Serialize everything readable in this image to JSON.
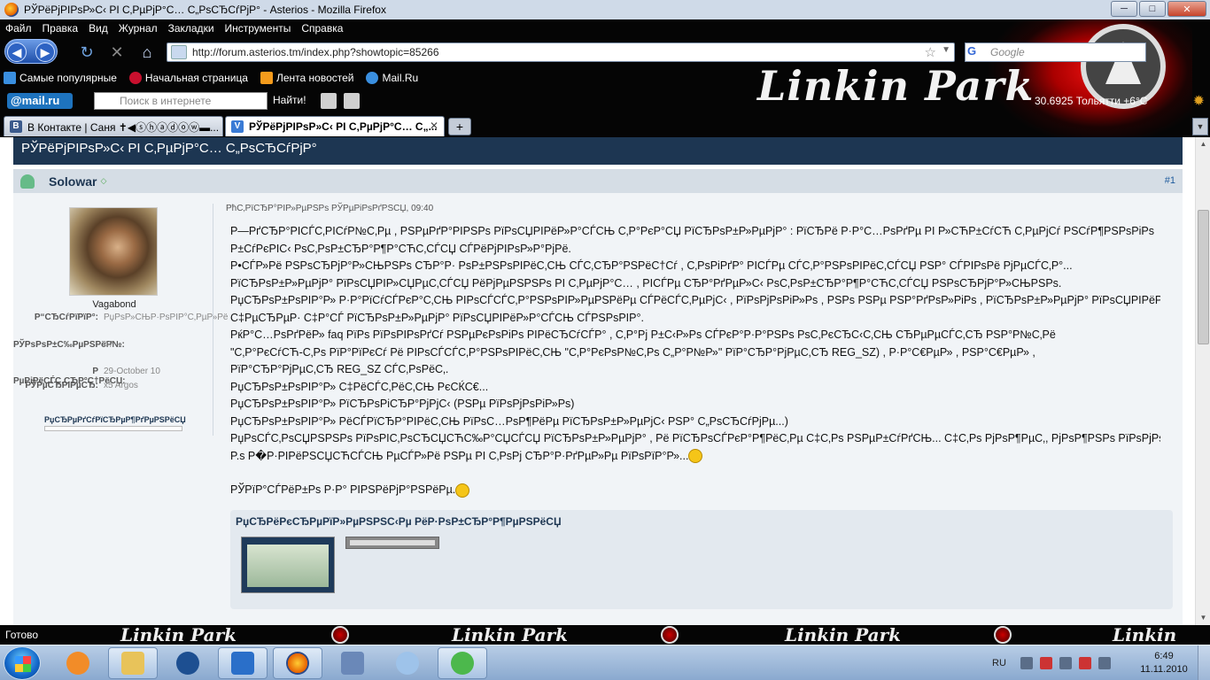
{
  "window": {
    "title": "РЎРёРјРІРѕР»С‹ РІ С‚РµРјР°С… С„РѕСЂСѓРјР° - Asterios - Mozilla Firefox",
    "buttons": {
      "minimize": "─",
      "maximize": "□",
      "close": "✕"
    }
  },
  "menubar": [
    "Файл",
    "Правка",
    "Вид",
    "Журнал",
    "Закладки",
    "Инструменты",
    "Справка"
  ],
  "navbar": {
    "url": "http://forum.asterios.tm/index.php?showtopic=85266",
    "search_placeholder": "Google",
    "search_engine_icon": "G"
  },
  "bookmarks": [
    {
      "label": "Самые популярные",
      "icon": "bookmark-icon",
      "color": "#3a8fe0"
    },
    {
      "label": "Начальная страница",
      "icon": "firefox-icon",
      "color": "#c8102e"
    },
    {
      "label": "Лента новостей",
      "icon": "rss-icon",
      "color": "#f49b1c"
    },
    {
      "label": "Mail.Ru",
      "icon": "mailru-icon",
      "color": "#3a8fe0"
    }
  ],
  "mailbar": {
    "logo": "@mail.ru",
    "search_placeholder": "Поиск в интернете",
    "find_label": "Найти!",
    "weather": "30.6925  Тольятти +6°C"
  },
  "persona_text": "Linkin Park",
  "tabs": [
    {
      "label": "В Контакте | Саня ✝◀ⓢⓗⓐⓓⓞⓦ▬...",
      "favicon": "В",
      "color": "#3b5a8c",
      "active": false
    },
    {
      "label": "РЎРёРјРІРѕР»С‹ РІ С‚РµРјР°С… С„...",
      "favicon": "V",
      "color": "#3a7bd5",
      "active": true
    }
  ],
  "forum": {
    "topic_title": "РЎРёРјРІРѕР»С‹ РІ С‚РµРјР°С… С„РѕСЂСѓРјР°",
    "post": {
      "author": "Solowar",
      "number": "#1",
      "date": "РћС‚РїСЂР°РІР»РµРЅРѕ РЎРµРіРѕРґРЅСЏ, 09:40",
      "avatar_name": "Vagabond",
      "user_info": [
        {
          "key": "Р“СЂСѓРїРїР°:",
          "value": "РџРѕР»СЊР·РѕРІР°С‚РµР»Рё"
        },
        {
          "key": "РЎРѕРѕР±С‰РµРЅРёР№:",
          "value": "47"
        },
        {
          "key": "Р РµРіРёСЃС‚СЂР°С†РёСЏ:",
          "value": "29-October 10"
        },
        {
          "key": "РЎРµСЂРІРµСЂ:",
          "value": "x5 Argos"
        }
      ],
      "reputation_label": "РџСЂРµРґСѓРїСЂРµР¶РґРµРЅРёСЏ",
      "lines": [
        "Р—РґСЂР°РІСЃС‚РІСѓР№С‚Рµ , РЅРµРґР°РІРЅРѕ РїРѕСЏРІРёР»Р°СЃСЊ С‚Р°РєР°СЏ РїСЂРѕР±Р»РµРјР° : РїСЂРё Р·Р°С…РѕРґРµ РІ Р»СЋР±СѓСЋ С‚РµРјСѓ РЅСѓР¶РЅРѕРіРѕ",
        "Р±СѓРєРІС‹ РѕС‚РѕР±СЂР°Р¶Р°СЋС‚СЃСЏ СЃРёРјРІРѕР»Р°РјРё.",
        "Р•СЃР»Рё РЅРѕСЂРјР°Р»СЊРЅРѕ СЂР°Р· РѕР±РЅРѕРІРёС‚СЊ СЃС‚СЂР°РЅРёС†Сѓ , С‚РѕРіРґР° РІСЃРµ СЃС‚Р°РЅРѕРІРёС‚СЃСЏ РЅР° СЃРІРѕРё РјРµСЃС‚Р°...",
        "РїСЂРѕР±Р»РµРјР° РїРѕСЏРІР»СЏРµС‚СЃСЏ РёРјРµРЅРЅРѕ РІ С‚РµРјР°С… , РІСЃРµ СЂР°РґРµР»С‹ РѕС‚РѕР±СЂР°Р¶Р°СЋС‚СЃСЏ РЅРѕСЂРјР°Р»СЊРЅРѕ.",
        "РџСЂРѕР±РѕРІР°Р» Р·Р°РїСѓСЃРєР°С‚СЊ РІРѕСЃСЃС‚Р°РЅРѕРІР»РµРЅРёРµ СЃРёСЃС‚РµРјС‹ , РїРѕРјРѕРіР»Рѕ , РЅРѕ РЅРµ РЅР°РґРѕР»РіРѕ , РїСЂРѕР±Р»РµРјР° РїРѕСЏРІРёР»Р°СЃСЊ",
        "С‡РµСЂРµР· С‡Р°СЃ РїСЂРѕР±Р»РµРјР° РїРѕСЏРІРёР»Р°СЃСЊ СЃРЅРѕРІР°.",
        "РќР°С…РѕРґРёР» faq РїРѕ РїРѕРІРѕРґСѓ РЅРµРєРѕРіРѕ РІРёСЂСѓСЃР° , С‚Р°Рј Р±С‹Р»Рѕ СЃРєР°Р·Р°РЅРѕ РѕС‚РєСЂС‹С‚СЊ СЂРµРµСЃС‚СЂ РЅР°Р№С‚Рё",
        "\"С‚Р°РєСѓСЋ-С‚Рѕ РїР°РїРєСѓ Рё РІРѕСЃСЃС‚Р°РЅРѕРІРёС‚СЊ \"С‚Р°РєРѕР№С‚Рѕ С„Р°Р№Р»\" РїР°СЂР°РјРµС‚СЂ REG_SZ) , Р·Р°С€РµР» , РЅР°С€РµР» ,",
        "РїР°СЂР°РјРµС‚СЂ REG_SZ СЃС‚РѕРёС‚.",
        "РџСЂРѕР±РѕРІР°Р» С‡РёСЃС‚РёС‚СЊ РєСЌС€...",
        "РџСЂРѕР±РѕРІР°Р» РїСЂРѕРіСЂР°РјРјС‹ (РЅРµ РїРѕРјРѕРіР»Рѕ)",
        "РџСЂРѕР±РѕРІР°Р» РёСЃРїСЂР°РІРёС‚СЊ РїРѕС…РѕР¶РёРµ РїСЂРѕР±Р»РµРјС‹ РЅР° С„РѕСЂСѓРјРµ...)",
        "РџРѕСЃС‚РѕСЏРЅРЅРѕ РїРѕРІС‚РѕСЂСЏСЋС‰Р°СЏСЃСЏ РїСЂРѕР±Р»РµРјР° , Рё РїСЂРѕСЃРєР°Р¶РёС‚Рµ С‡С‚Рѕ РЅРµР±СѓРґСЊ... С‡С‚Рѕ РјРѕР¶РµС‚, РјРѕР¶РЅРѕ РїРѕРјРѕС‡СЊ)",
        "P.s Р�Р·РІРёРЅСЏСЋСЃСЊ РµСЃР»Рё РЅРµ РІ С‚РѕРј СЂР°Р·РґРµР»Рµ РїРѕРїР°Р»..."
      ],
      "signature": "РЎРїР°СЃРёР±Рѕ Р·Р° РІРЅРёРјР°РЅРёРµ.",
      "attachment_title": "РџСЂРёРєСЂРµРїР»РµРЅРЅС‹Рµ РёР·РѕР±СЂР°Р¶РµРЅРёСЏ"
    }
  },
  "statusbar": {
    "text": "Готово",
    "persona_text": "Linkin Park"
  },
  "taskbar": {
    "apps": [
      {
        "name": "media-player",
        "icon": "media-player-icon",
        "color": "#f28c28",
        "active": false
      },
      {
        "name": "explorer",
        "icon": "folder-icon",
        "color": "#e8c35a",
        "active": true
      },
      {
        "name": "hp",
        "icon": "hp-icon",
        "color": "#1d4f91",
        "active": false
      },
      {
        "name": "tasks",
        "icon": "checkmark-icon",
        "color": "#2a6fc9",
        "active": true
      },
      {
        "name": "firefox",
        "icon": "firefox-icon",
        "color": "#e66000",
        "active": true
      },
      {
        "name": "keyboard",
        "icon": "keyboard-icon",
        "color": "#6a88b8",
        "active": false
      },
      {
        "name": "search",
        "icon": "magnifier-icon",
        "color": "#9ec3ea",
        "active": false
      },
      {
        "name": "icq",
        "icon": "flower-icon",
        "color": "#4cb84c",
        "active": true
      }
    ],
    "language": "RU",
    "time": "6:49",
    "date": "11.11.2010"
  },
  "colors": {
    "forum_header": "#1d3652",
    "post_bg": "#f1f4f7",
    "chrome_bg": "#050505"
  }
}
